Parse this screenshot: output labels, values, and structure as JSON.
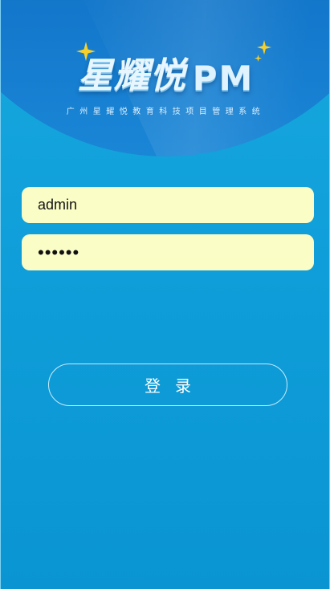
{
  "colors": {
    "background": "#0f9ed9",
    "header": "#1275c9",
    "input_bg": "#fbfdc7",
    "star": "#f7d02c",
    "button_border": "#c9ecfb"
  },
  "logo": {
    "title": "星耀悦",
    "suffix": "PM",
    "subtitle": "广州星耀悦教育科技项目管理系统"
  },
  "form": {
    "username": {
      "value": "admin"
    },
    "password": {
      "value": "••••••"
    }
  },
  "actions": {
    "login_label": "登录"
  }
}
